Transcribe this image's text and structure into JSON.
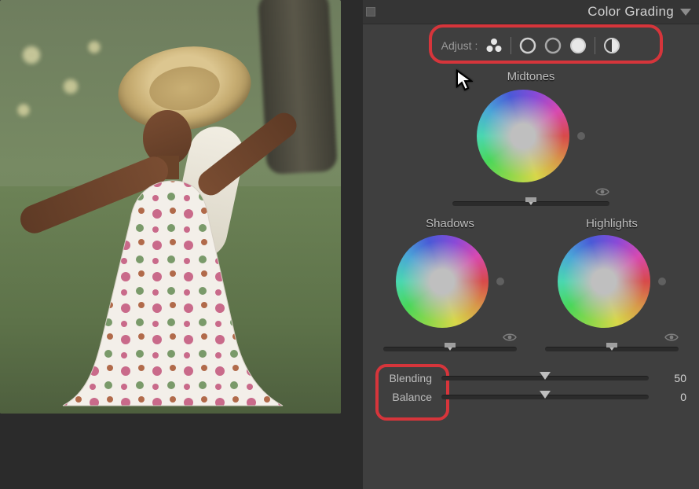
{
  "panel": {
    "title": "Color Grading",
    "adjust_label": "Adjust :",
    "icons": {
      "three": "three-way-icon",
      "shadows": "shadows-target-icon",
      "midtones": "midtones-target-icon",
      "highlights": "highlights-target-icon",
      "global": "global-target-icon"
    }
  },
  "midtones": {
    "title": "Midtones",
    "sat": 0
  },
  "shadows": {
    "title": "Shadows",
    "sat": 0
  },
  "highlights": {
    "title": "Highlights",
    "sat": 0
  },
  "params": {
    "blending": {
      "label": "Blending",
      "value": "50",
      "pos": 50
    },
    "balance": {
      "label": "Balance",
      "value": "0",
      "pos": 50
    }
  },
  "annotations": {
    "color": "#d6353b"
  }
}
